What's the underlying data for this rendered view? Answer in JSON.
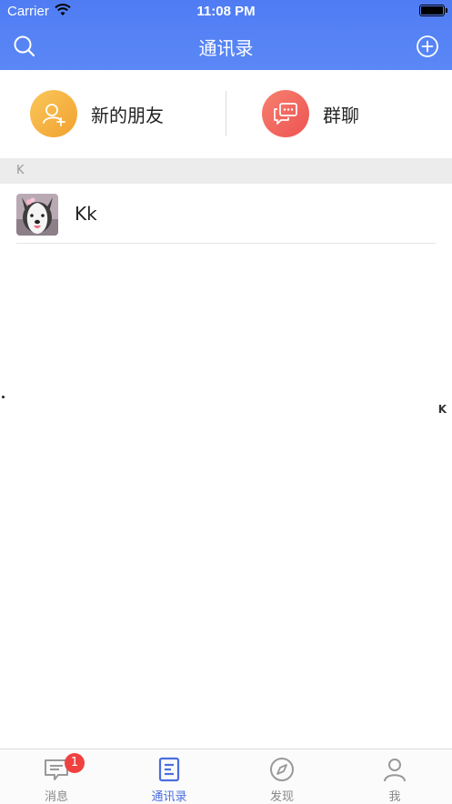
{
  "status_bar": {
    "carrier": "Carrier",
    "time": "11:08 PM"
  },
  "nav": {
    "title": "通讯录",
    "left_icon": "search-icon",
    "right_icon": "add-circle-icon"
  },
  "quick_actions": [
    {
      "label": "新的朋友",
      "icon": "new-friend-icon",
      "color": "#f5b13d"
    },
    {
      "label": "群聊",
      "icon": "group-chat-icon",
      "color": "#f0645a"
    }
  ],
  "sections": [
    {
      "letter": "K",
      "contacts": [
        {
          "name": "Kk",
          "avatar": "dog-avatar"
        }
      ]
    }
  ],
  "index_bar": [
    "K"
  ],
  "tabs": [
    {
      "label": "消息",
      "icon": "message-icon",
      "badge": "1",
      "active": false
    },
    {
      "label": "通讯录",
      "icon": "contacts-icon",
      "active": true
    },
    {
      "label": "发现",
      "icon": "compass-icon",
      "active": false
    },
    {
      "label": "我",
      "icon": "profile-icon",
      "active": false
    }
  ],
  "colors": {
    "accent": "#4a6ee0",
    "header": "#5282f5",
    "badge": "#f04141"
  }
}
